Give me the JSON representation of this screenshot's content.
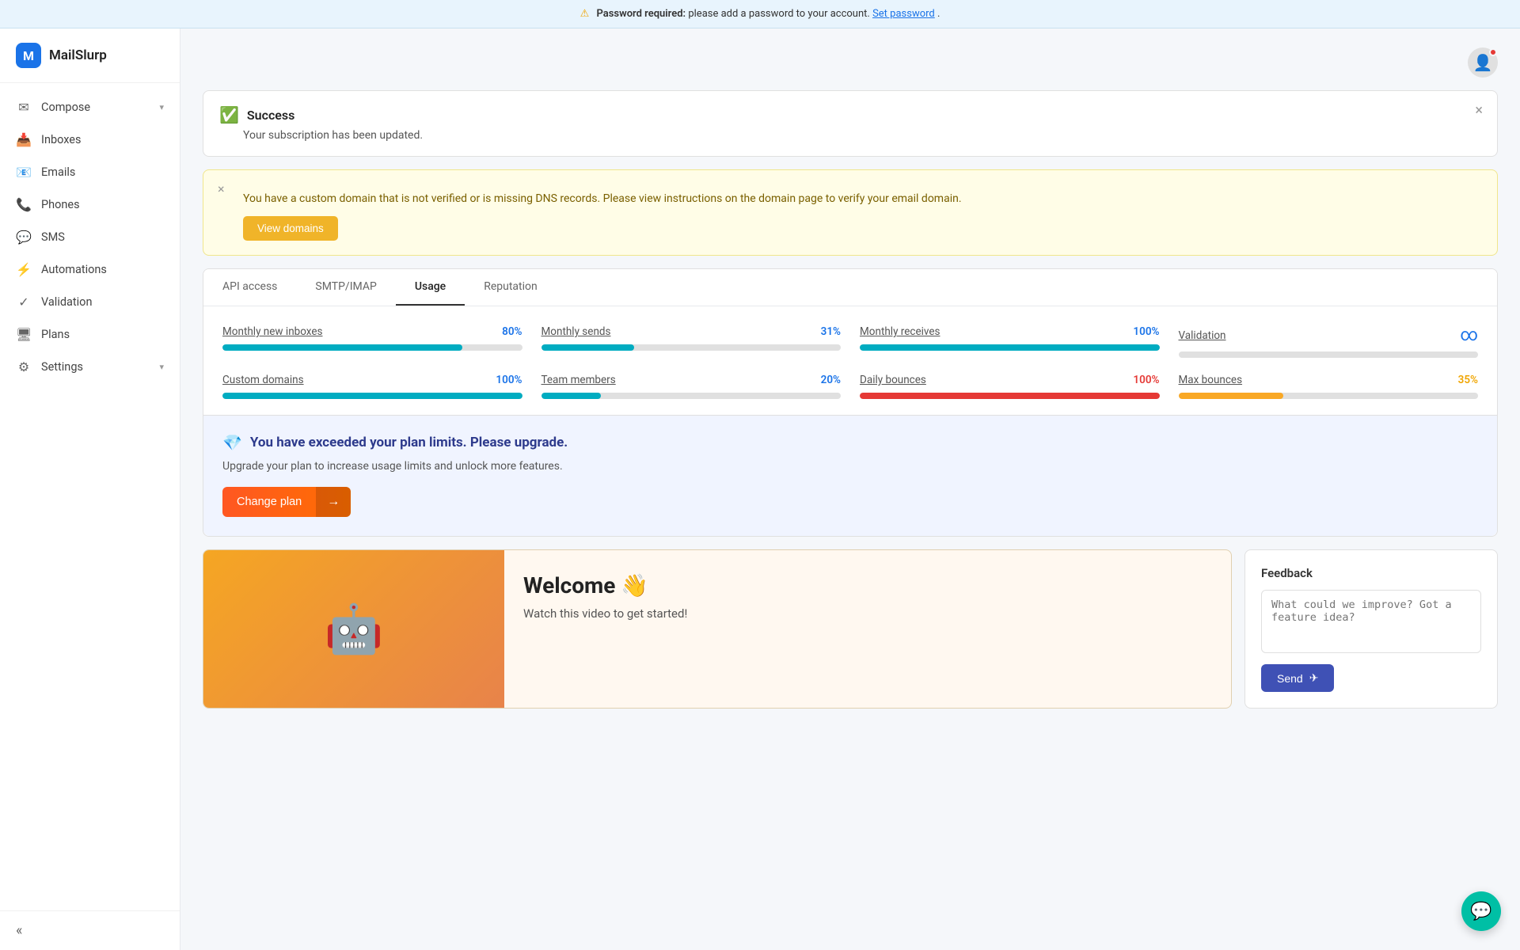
{
  "banner": {
    "text_prefix": "Password required:",
    "text_body": " please add a password to your account.",
    "link_text": "Set password",
    "link_suffix": "."
  },
  "sidebar": {
    "logo_letter": "M",
    "logo_name": "MailSlurp",
    "nav_items": [
      {
        "id": "compose",
        "label": "Compose",
        "icon": "✉",
        "has_chevron": true
      },
      {
        "id": "inboxes",
        "label": "Inboxes",
        "icon": "📥",
        "has_chevron": false
      },
      {
        "id": "emails",
        "label": "Emails",
        "icon": "📧",
        "has_chevron": false
      },
      {
        "id": "phones",
        "label": "Phones",
        "icon": "📞",
        "has_chevron": false
      },
      {
        "id": "sms",
        "label": "SMS",
        "icon": "💬",
        "has_chevron": false
      },
      {
        "id": "automations",
        "label": "Automations",
        "icon": "⚡",
        "has_chevron": false
      },
      {
        "id": "validation",
        "label": "Validation",
        "icon": "✓",
        "has_chevron": false
      },
      {
        "id": "plans",
        "label": "Plans",
        "icon": "🖥",
        "has_chevron": false
      },
      {
        "id": "settings",
        "label": "Settings",
        "icon": "⚙",
        "has_chevron": true
      }
    ],
    "collapse_icon": "«"
  },
  "alerts": {
    "success": {
      "title": "Success",
      "body": "Your subscription has been updated."
    },
    "warning": {
      "body": "You have a custom domain that is not verified or is missing DNS records. Please view instructions on the domain page to verify your email domain.",
      "btn_label": "View domains"
    }
  },
  "tabs": [
    {
      "id": "api-access",
      "label": "API access"
    },
    {
      "id": "smtp-imap",
      "label": "SMTP/IMAP"
    },
    {
      "id": "usage",
      "label": "Usage",
      "active": true
    },
    {
      "id": "reputation",
      "label": "Reputation"
    }
  ],
  "usage": {
    "items": [
      {
        "id": "monthly-new-inboxes",
        "label": "Monthly new inboxes",
        "value": "80%",
        "value_color": "blue",
        "fill_pct": 80,
        "fill_color": "teal"
      },
      {
        "id": "monthly-sends",
        "label": "Monthly sends",
        "value": "31%",
        "value_color": "blue",
        "fill_pct": 31,
        "fill_color": "teal"
      },
      {
        "id": "monthly-receives",
        "label": "Monthly receives",
        "value": "100%",
        "value_color": "blue",
        "fill_pct": 100,
        "fill_color": "teal"
      },
      {
        "id": "validation",
        "label": "Validation",
        "value": "∞",
        "value_color": "blue",
        "fill_pct": 0,
        "fill_color": "teal",
        "is_infinity": true
      },
      {
        "id": "custom-domains",
        "label": "Custom domains",
        "value": "100%",
        "value_color": "blue",
        "fill_pct": 100,
        "fill_color": "teal"
      },
      {
        "id": "team-members",
        "label": "Team members",
        "value": "20%",
        "value_color": "blue",
        "fill_pct": 20,
        "fill_color": "teal"
      },
      {
        "id": "daily-bounces",
        "label": "Daily bounces",
        "value": "100%",
        "value_color": "red",
        "fill_pct": 100,
        "fill_color": "red"
      },
      {
        "id": "max-bounces",
        "label": "Max bounces",
        "value": "35%",
        "value_color": "yellow",
        "fill_pct": 35,
        "fill_color": "yellow"
      }
    ]
  },
  "upgrade": {
    "title": "You have exceeded your plan limits. Please upgrade.",
    "body": "Upgrade your plan to increase usage limits and unlock more features.",
    "btn_label": "Change plan",
    "btn_arrow": "→"
  },
  "welcome": {
    "title": "Welcome 👋",
    "subtitle": "Watch this video to get started!",
    "emoji": "🤖"
  },
  "feedback": {
    "title": "Feedback",
    "placeholder": "What could we improve? Got a feature idea?",
    "send_label": "Send",
    "send_icon": "✈"
  }
}
